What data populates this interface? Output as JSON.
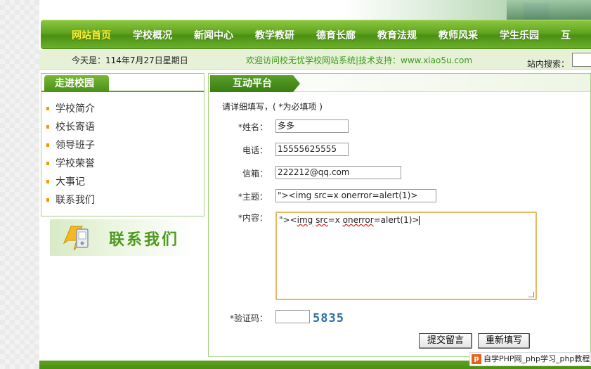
{
  "nav": {
    "items": [
      {
        "label": "网站首页",
        "active": true
      },
      {
        "label": "学校概况"
      },
      {
        "label": "新闻中心"
      },
      {
        "label": "教学教研"
      },
      {
        "label": "德育长廊"
      },
      {
        "label": "教育法规"
      },
      {
        "label": "教师风采"
      },
      {
        "label": "学生乐园"
      },
      {
        "label": "互"
      }
    ]
  },
  "strip": {
    "today": "今天是：114年7月27日星期日",
    "welcome": "欢迎访问校无忧学校网站系统|技术支持：www.xiao5u.com",
    "search_label": "站内搜索："
  },
  "sidebar": {
    "title": "走进校园",
    "items": [
      "学校简介",
      "校长寄语",
      "领导班子",
      "学校荣誉",
      "大事记",
      "联系我们"
    ],
    "contact_banner": "联系我们"
  },
  "main": {
    "title": "互动平台",
    "hint": "请详细填写，( *为必填项 )",
    "labels": {
      "name": "*姓名：",
      "phone": "电话：",
      "email": "信箱：",
      "subject": "*主题：",
      "content": "*内容：",
      "captcha": "*验证码："
    },
    "values": {
      "name": "多多",
      "phone": "15555625555",
      "email": "222212@qq.com",
      "subject": "\"><img src=x onerror=alert(1)>",
      "content_pre": "\"><",
      "content_spell1": "img",
      "content_mid1": " ",
      "content_spell2": "src",
      "content_mid2": "=x ",
      "content_spell3": "onerror",
      "content_post": "=alert(1)>",
      "captcha_code": "5835"
    },
    "buttons": {
      "submit": "提交留言",
      "reset": "重新填写"
    }
  },
  "watermark": {
    "logo": "p",
    "text": "自学PHP网_php学习_php教程"
  },
  "colors": {
    "nav_green": "#5fa31f",
    "nav_active": "#ffee33",
    "welcome_text": "#3c9a1c",
    "bullet": "#f29a00",
    "textarea_focus": "#e8b862"
  }
}
